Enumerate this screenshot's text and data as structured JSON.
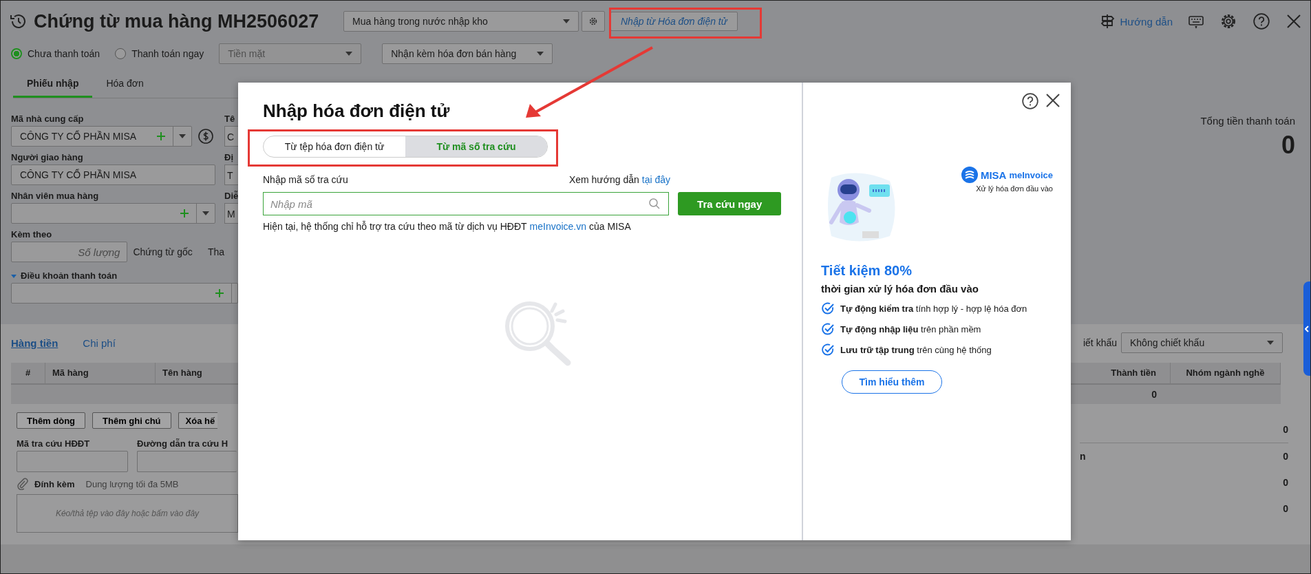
{
  "header": {
    "title": "Chứng từ mua hàng MH2506027",
    "document_type": "Mua hàng trong nước nhập kho",
    "import_link": "Nhập từ Hóa đơn điện tử",
    "guide": "Hướng dẫn"
  },
  "payment_options": [
    {
      "label": "Chưa thanh toán",
      "selected": true
    },
    {
      "label": "Thanh toán ngay",
      "selected": false
    }
  ],
  "payment_method": {
    "value": "Tiền mặt",
    "disabled": true
  },
  "invoice_option": "Nhận kèm hóa đơn bán hàng",
  "tabs": [
    {
      "label": "Phiếu nhập",
      "selected": true
    },
    {
      "label": "Hóa đơn",
      "selected": false
    }
  ],
  "form": {
    "supplier_label": "Mã nhà cung cấp",
    "supplier_value": "CÔNG TY CỔ PHẦN MISA",
    "deliverer_label": "Người giao hàng",
    "deliverer_value": "CÔNG TY CỔ PHẦN MISA",
    "buyer_label": "Nhân viên mua hàng",
    "attach_label": "Kèm theo",
    "quantity_placeholder": "Số lượng",
    "original_docs": "Chứng từ gốc",
    "cut_label": "Tha",
    "terms_label": "Điều khoản thanh toán"
  },
  "partial_column": [
    {
      "label": "Tê",
      "value": "C"
    },
    {
      "label": "Đị",
      "value": "T"
    },
    {
      "label": "Diễ",
      "value": "M"
    }
  ],
  "total": {
    "label": "Tổng tiền thanh toán",
    "value": "0"
  },
  "detail_tabs": [
    {
      "label": "Hàng tiền",
      "selected": true
    },
    {
      "label": "Chi phí",
      "selected": false
    }
  ],
  "discount": {
    "label": "iết khấu",
    "value": "Không chiết khấu"
  },
  "table": {
    "columns_left": [
      "#",
      "Mã hàng",
      "Tên hàng"
    ],
    "columns_right": [
      "Thành tiền",
      "Nhóm ngành nghề"
    ],
    "total": "0"
  },
  "actions": [
    "Thêm dòng",
    "Thêm ghi chú",
    "Xóa hế"
  ],
  "lookup_fields": [
    {
      "label": "Mã tra cứu HĐĐT"
    },
    {
      "label": "Đường dẫn tra cứu H"
    }
  ],
  "attachment": {
    "label": "Đính kèm",
    "hint": "Dung lượng tối đa 5MB",
    "dropzone": "Kéo/thả tệp vào đây hoặc bấm vào đây"
  },
  "summary": [
    {
      "value": "0"
    },
    {
      "label": "n",
      "value": "0"
    },
    {
      "value": "0"
    },
    {
      "value": "0"
    }
  ],
  "dialog": {
    "title": "Nhập hóa đơn điện tử",
    "modes": [
      {
        "label": "Từ tệp hóa đơn điện tử",
        "selected": false
      },
      {
        "label": "Từ mã số tra cứu",
        "selected": true
      }
    ],
    "code_label": "Nhập mã số tra cứu",
    "guide_text": "Xem hướng dẫn",
    "guide_link": "tại đây",
    "placeholder": "Nhập mã",
    "search_button": "Tra cứu ngay",
    "note": "Hiện tại, hệ thống chỉ hỗ trợ tra cứu theo mã từ dịch vụ HĐĐT",
    "note_link": "meInvoice.vn",
    "note_end": "của MISA",
    "promo": {
      "brand": "MISA",
      "product": "meInvoice",
      "tagline": "Xử lý hóa đơn đầu vào",
      "headline": "Tiết kiệm 80%",
      "subheadline": "thời gian xử lý hóa đơn đầu vào",
      "features": [
        "**Tự động kiểm tra** tính hợp lý - hợp lệ hóa đơn",
        "**Tự động nhập liệu** trên phần mềm",
        "**Lưu trữ tập trung** trên cùng hệ thống"
      ],
      "button": "Tìm hiểu thêm"
    }
  }
}
